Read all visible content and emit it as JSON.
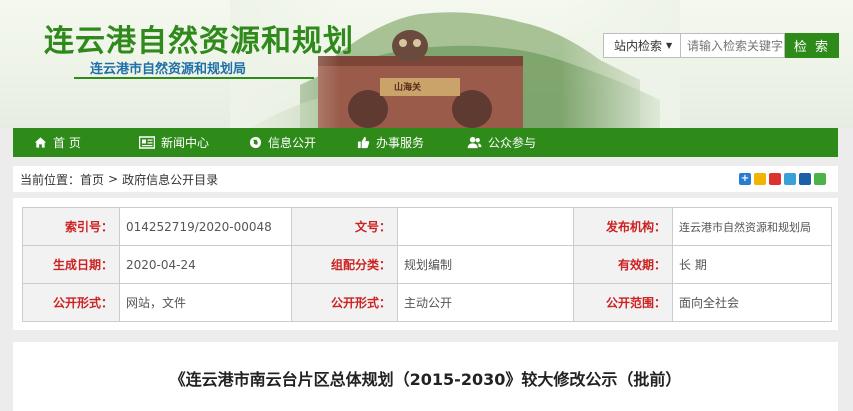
{
  "header": {
    "site_title": "连云港自然资源和规划",
    "site_subtitle": "连云港市自然资源和规划局",
    "gate_inscription": "山海关"
  },
  "search": {
    "scope_label": "站内检索",
    "scope_arrow": "▼",
    "placeholder": "请输入检索关键字",
    "button_label": "检 索"
  },
  "nav": {
    "items": [
      {
        "label": "首 页",
        "icon": "home-icon"
      },
      {
        "label": "新闻中心",
        "icon": "newspaper-icon"
      },
      {
        "label": "信息公开",
        "icon": "globe-icon"
      },
      {
        "label": "办事服务",
        "icon": "thumbs-up-icon"
      },
      {
        "label": "公众参与",
        "icon": "users-icon"
      }
    ]
  },
  "breadcrumb": {
    "prefix": "当前位置：",
    "home": "首页",
    "separator": ">",
    "current": "政府信息公开目录"
  },
  "share_icons": [
    "plus-share-icon",
    "qzone-icon",
    "weibo-icon",
    "tencent-weibo-icon",
    "renren-icon",
    "wechat-icon"
  ],
  "meta": {
    "rows": [
      [
        {
          "label": "索引号：",
          "value": "014252719/2020-00048"
        },
        {
          "label": "文号：",
          "value": ""
        },
        {
          "label": "发布机构：",
          "value": "连云港市自然资源和规划局"
        }
      ],
      [
        {
          "label": "生成日期：",
          "value": "2020-04-24"
        },
        {
          "label": "组配分类：",
          "value": "规划编制"
        },
        {
          "label": "有效期：",
          "value": "长 期"
        }
      ],
      [
        {
          "label": "公开形式：",
          "value": "网站，文件"
        },
        {
          "label": "公开形式：",
          "value": "主动公开"
        },
        {
          "label": "公开范围：",
          "value": "面向全社会"
        }
      ]
    ]
  },
  "article": {
    "title": "《连云港市南云台片区总体规划（2015-2030》较大修改公示（批前）"
  },
  "colors": {
    "brand_green": "#2e8b1a",
    "title_green": "#2f8a1b",
    "subtitle_blue": "#1f6fa8",
    "label_red": "#cc2222"
  }
}
